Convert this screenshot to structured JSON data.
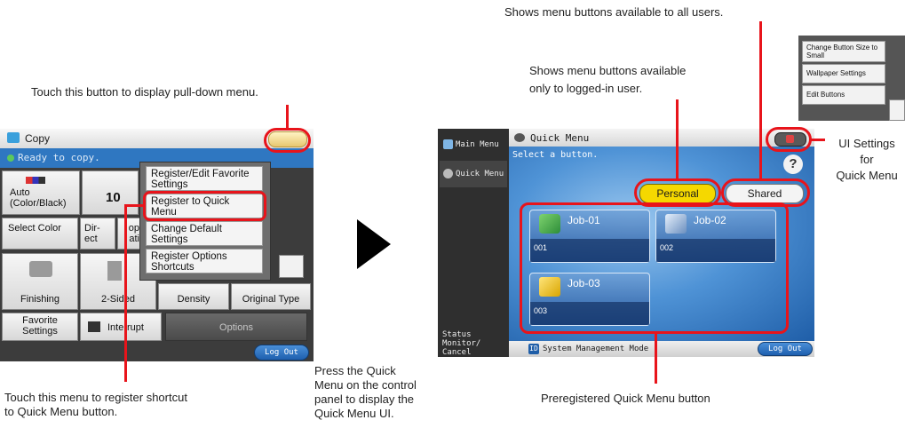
{
  "annotations": {
    "top_center": "Shows menu buttons available to all users.",
    "logged_in_1": "Shows menu buttons available",
    "logged_in_2": "only to logged-in user.",
    "pulldown": "Touch this button to display pull-down menu.",
    "ui_settings_1": "UI Settings",
    "ui_settings_2": "for",
    "ui_settings_3": "Quick Menu",
    "register_1": "Touch this menu to register shortcut",
    "register_2": " to Quick Menu button.",
    "press_1": "Press the Quick",
    "press_2": "Menu on the control",
    "press_3": "panel to display the",
    "press_4": "Quick Menu UI.",
    "preregistered": "Preregistered Quick Menu button"
  },
  "copy_screen": {
    "title": "Copy",
    "status": "Ready to copy.",
    "color_mode_1": "Auto",
    "color_mode_2": "(Color/Black)",
    "count_partial": "10",
    "select_color": "Select Color",
    "direct_1": "Dir-",
    "direct_2": "ect",
    "cop_1": "op",
    "cop_2": "ati",
    "finishing": "Finishing",
    "two_sided": "2-Sided",
    "density": "Density",
    "original_type": "Original Type",
    "favorite_1": "Favorite",
    "favorite_2": "Settings",
    "interrupt": "Interrupt",
    "options": "Options",
    "log_out": "Log Out",
    "menu": [
      {
        "l1": "Register/Edit Favorite",
        "l2": "Settings"
      },
      {
        "l1": "Register to Quick",
        "l2": "Menu"
      },
      {
        "l1": "Change Default",
        "l2": "Settings"
      },
      {
        "l1": "Register Options",
        "l2": "Shortcuts"
      }
    ]
  },
  "quick_menu_screen": {
    "main_menu": "Main Menu",
    "quick_menu": "Quick Menu",
    "title": "Quick Menu",
    "prompt": "Select a button.",
    "personal": "Personal",
    "shared": "Shared",
    "help": "?",
    "status_monitor_1": "Status Monitor/",
    "status_monitor_2": "Cancel",
    "id_badge": "ID",
    "system_mode": "System Management Mode",
    "log_out": "Log Out",
    "jobs": [
      {
        "name": "Job-01",
        "number": "001"
      },
      {
        "name": "Job-02",
        "number": "002"
      },
      {
        "name": "Job-03",
        "number": "003"
      }
    ]
  },
  "settings_popup": {
    "items": [
      {
        "l1": "Change Button Size to",
        "l2": "Small"
      },
      {
        "l1": "Wallpaper Settings",
        "l2": ""
      },
      {
        "l1": "Edit Buttons",
        "l2": ""
      }
    ]
  },
  "colors": {
    "highlight": "#e8141b",
    "personal": "#f5d800",
    "accent_blue": "#2f77c1"
  }
}
